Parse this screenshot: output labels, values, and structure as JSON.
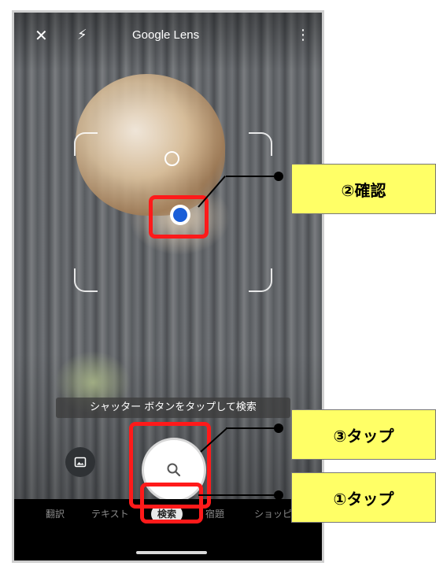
{
  "app": {
    "title": "Google Lens"
  },
  "topbar": {
    "close_icon": "✕",
    "flash_icon": "⚡",
    "more_icon": "⋮"
  },
  "hint": "シャッター ボタンをタップして検索",
  "tabs": [
    {
      "label": "翻訳"
    },
    {
      "label": "テキスト"
    },
    {
      "label": "検索",
      "active": true
    },
    {
      "label": "宿題"
    },
    {
      "label": "ショッピ"
    }
  ],
  "callouts": {
    "confirm": "②確認",
    "tap_shutter": "③タップ",
    "tap_tab": "①タップ"
  },
  "colors": {
    "highlight": "#ff1a1a",
    "callout_bg": "#ffff66",
    "dot": "#1a5ed8"
  }
}
